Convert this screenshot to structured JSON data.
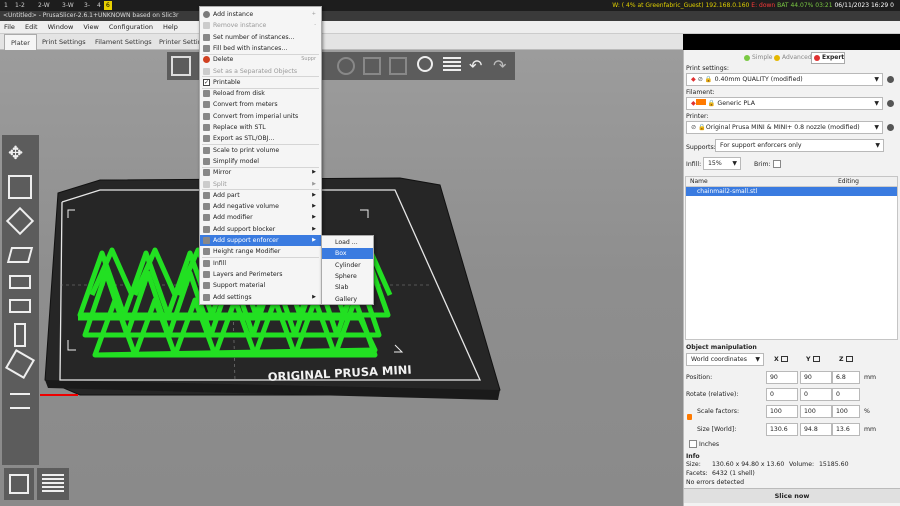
{
  "sysbar": {
    "workspaces": [
      "1",
      "1-2",
      "2-W",
      "3-W",
      "3-",
      "4",
      "6"
    ],
    "active_workspace": "6",
    "wifi": "W: ( 4% at Greenfabric_Guest) 192.168.0.160",
    "eth": "E: down",
    "battery": "BAT 44.07% 03:21",
    "datetime": "06/11/2023 16:29",
    "extra": "0"
  },
  "title": "<Untitled> - PrusaSlicer-2.6.1+UNKNOWN based on Slic3r",
  "menubar": [
    "File",
    "Edit",
    "Window",
    "View",
    "Configuration",
    "Help"
  ],
  "tabs": [
    "Plater",
    "Print Settings",
    "Filament Settings",
    "Printer Settings"
  ],
  "bed_label": "ORIGINAL PRUSA MINI",
  "context_menu": {
    "items": [
      {
        "label": "Add instance",
        "shortcut": "+",
        "icon": "plus-icon"
      },
      {
        "label": "Remove instance",
        "shortcut": "-",
        "disabled": true
      },
      {
        "label": "Set number of instances..."
      },
      {
        "label": "Fill bed with instances..."
      },
      {
        "label": "Delete",
        "shortcut": "Suppr",
        "icon": "delete-icon"
      },
      {
        "label": "Set as a Separated Objects",
        "disabled": true
      },
      {
        "label": "Printable",
        "checked": true
      },
      {
        "label": "Reload from disk"
      },
      {
        "label": "Convert from meters"
      },
      {
        "label": "Convert from imperial units"
      },
      {
        "label": "Replace with STL"
      },
      {
        "label": "Export as STL/OBJ..."
      },
      {
        "label": "Scale to print volume"
      },
      {
        "label": "Simplify model"
      },
      {
        "label": "Mirror",
        "submenu": true
      },
      {
        "label": "Split",
        "submenu": true,
        "disabled": true
      },
      {
        "label": "Add part",
        "submenu": true
      },
      {
        "label": "Add negative volume",
        "submenu": true
      },
      {
        "label": "Add modifier",
        "submenu": true
      },
      {
        "label": "Add support blocker",
        "submenu": true
      },
      {
        "label": "Add support enforcer",
        "submenu": true,
        "highlighted": true
      },
      {
        "label": "Height range Modifier"
      },
      {
        "label": "Infill"
      },
      {
        "label": "Layers and Perimeters"
      },
      {
        "label": "Support material"
      },
      {
        "label": "Add settings",
        "submenu": true
      }
    ],
    "submenu": [
      "Load ...",
      "Box",
      "Cylinder",
      "Sphere",
      "Slab",
      "Gallery"
    ],
    "submenu_highlight": "Box"
  },
  "panel": {
    "modes": [
      "Simple",
      "Advanced",
      "Expert"
    ],
    "print_settings_label": "Print settings:",
    "print_settings_value": "0.40mm QUALITY (modified)",
    "filament_label": "Filament:",
    "filament_value": "Generic PLA",
    "printer_label": "Printer:",
    "printer_value": "Original Prusa MINI & MINI+ 0.8 nozzle (modified)",
    "supports_label": "Supports:",
    "supports_value": "For support enforcers only",
    "infill_label": "Infill:",
    "infill_value": "15%",
    "brim_label": "Brim:",
    "list_headers": [
      "Name",
      "Editing"
    ],
    "object_name": "chainmail2-small.stl",
    "om_title": "Object manipulation",
    "coords": "World coordinates",
    "axes": [
      "X",
      "Y",
      "Z"
    ],
    "rows": [
      {
        "label": "Position:",
        "values": [
          "90",
          "90",
          "6.8"
        ],
        "unit": "mm"
      },
      {
        "label": "Rotate (relative):",
        "values": [
          "0",
          "0",
          "0"
        ],
        "unit": ""
      },
      {
        "label": "Scale factors:",
        "values": [
          "100",
          "100",
          "100"
        ],
        "unit": "%"
      },
      {
        "label": "Size [World]:",
        "values": [
          "130.6",
          "94.8",
          "13.6"
        ],
        "unit": "mm"
      }
    ],
    "inches_label": "Inches",
    "info_title": "Info",
    "size_label": "Size:",
    "size_value": "130.60 x 94.80 x 13.60",
    "volume_label": "Volume:",
    "volume_value": "15185.60",
    "facets_label": "Facets:",
    "facets_value": "6432 (1 shell)",
    "errors": "No errors detected",
    "slice_button": "Slice now"
  },
  "colors": {
    "accent": "#3a7be0",
    "model_green": "#22e022",
    "bed": "#262626",
    "viewport": "#969696"
  }
}
